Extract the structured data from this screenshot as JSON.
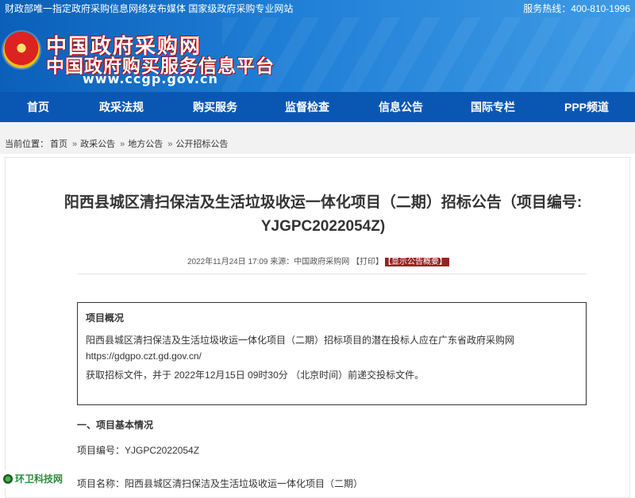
{
  "top_strip": {
    "tagline": "财政部唯一指定政府采购信息网络发布媒体 国家级政府采购专业网站",
    "hotline_label": "服务热线：",
    "hotline_number": "400-810-1996"
  },
  "header": {
    "logo_title": "中国政府采购网",
    "logo_subtitle": "中国政府购买服务信息平台",
    "logo_url": "www.ccgp.gov.cn"
  },
  "nav": {
    "items": [
      {
        "label": "首页"
      },
      {
        "label": "政采法规"
      },
      {
        "label": "购买服务"
      },
      {
        "label": "监督检查"
      },
      {
        "label": "信息公告"
      },
      {
        "label": "国际专栏"
      },
      {
        "label": "PPP频道"
      }
    ]
  },
  "breadcrumb": {
    "prefix": "当前位置：",
    "items": [
      "首页",
      "政采公告",
      "地方公告",
      "公开招标公告"
    ],
    "separator": "»"
  },
  "article": {
    "title_line1": "阳西县城区清扫保洁及生活垃圾收运一体化项目（二期）招标公告（项目编号:",
    "title_line2": "YJGPC2022054Z)",
    "meta_date": "2022年11月24日 17:09",
    "meta_source": "来源：中国政府采购网",
    "meta_print": "【打印】",
    "meta_summary": "【显示公告概要】",
    "overview_heading": "项目概况",
    "overview_line1": "阳西县城区清扫保洁及生活垃圾收运一体化项目（二期）招标项目的潜在投标人应在广东省政府采购网",
    "overview_line2": "https://gdgpo.czt.gd.gov.cn/",
    "overview_line3": "获取招标文件，并于 2022年12月15日 09时30分 （北京时间）前递交投标文件。",
    "section1_heading": "一、项目基本情况",
    "project_no": "项目编号：YJGPC2022054Z",
    "project_name": "项目名称：阳西县城区清扫保洁及生活垃圾收运一体化项目（二期）"
  },
  "watermark": {
    "text": "环卫科技网"
  },
  "colors": {
    "nav_bg": "#0a57b3",
    "header_gradient_start": "#0b5fb8",
    "badge_bg": "#9d1f1f"
  }
}
